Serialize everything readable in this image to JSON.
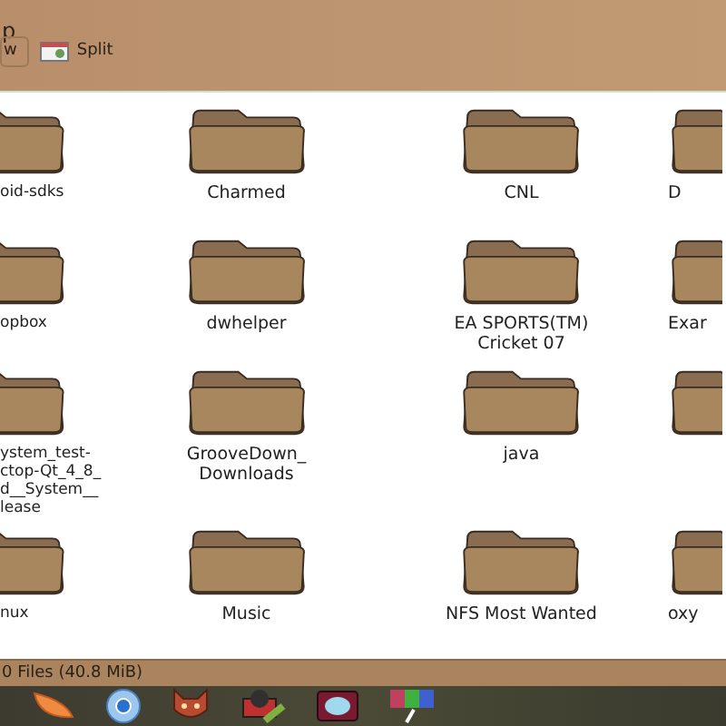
{
  "toolbar": {
    "title_fragment": "p",
    "buttons": [
      {
        "label": "w",
        "kind": "plain"
      },
      {
        "label": "Split",
        "kind": "split"
      }
    ]
  },
  "folders": [
    {
      "kind": "folder",
      "label": "oid-sdks"
    },
    {
      "kind": "folder",
      "label": "Charmed"
    },
    {
      "kind": "folder",
      "label": "CNL"
    },
    {
      "kind": "folder",
      "label": "D"
    },
    {
      "kind": "folder",
      "label": "opbox"
    },
    {
      "kind": "folder",
      "label": "dwhelper"
    },
    {
      "kind": "folder",
      "label": "EA SPORTS(TM) Cricket 07"
    },
    {
      "kind": "folder",
      "label": "Exar"
    },
    {
      "kind": "folder",
      "label": "ystem_test-\nctop-Qt_4_8_\nd__System__\nlease"
    },
    {
      "kind": "folder",
      "label": "GrooveDown_ Downloads"
    },
    {
      "kind": "folder",
      "label": "java"
    },
    {
      "kind": "folder"
    },
    {
      "kind": "folder",
      "label": "nux"
    },
    {
      "kind": "folder",
      "label": "Music"
    },
    {
      "kind": "folder",
      "label": "NFS Most Wanted"
    },
    {
      "kind": "folder",
      "label": "oxy"
    }
  ],
  "status_bar": "0 Files (40.8 MiB)",
  "launcher": [
    {
      "kind": "orange"
    },
    {
      "kind": "browser"
    },
    {
      "kind": "fox"
    },
    {
      "kind": "camera"
    },
    {
      "kind": "monitor"
    },
    {
      "kind": "palette"
    }
  ]
}
